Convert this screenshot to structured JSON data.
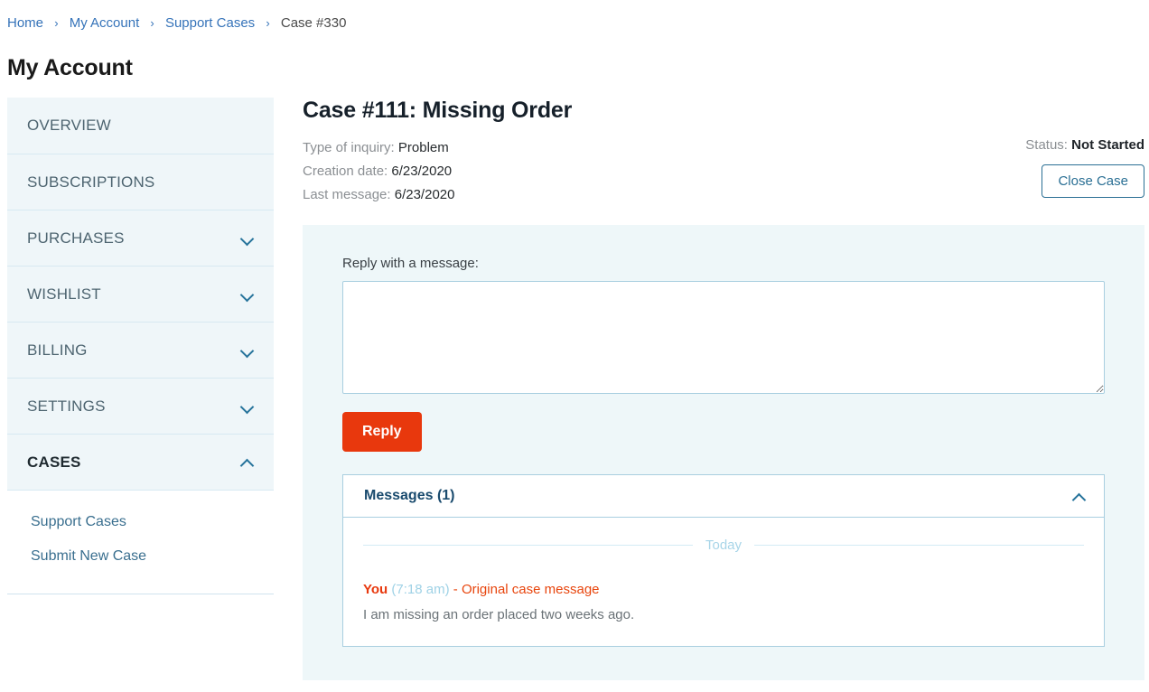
{
  "breadcrumb": {
    "separator": "›",
    "items": [
      {
        "label": "Home",
        "current": false
      },
      {
        "label": "My Account",
        "current": false
      },
      {
        "label": "Support Cases",
        "current": false
      },
      {
        "label": "Case #330",
        "current": true
      }
    ]
  },
  "page_title": "My Account",
  "sidebar": {
    "items": [
      {
        "label": "OVERVIEW",
        "chevron": "none",
        "active": false
      },
      {
        "label": "SUBSCRIPTIONS",
        "chevron": "none",
        "active": false
      },
      {
        "label": "PURCHASES",
        "chevron": "chevron-down-icon",
        "active": false
      },
      {
        "label": "WISHLIST",
        "chevron": "chevron-down-icon",
        "active": false
      },
      {
        "label": "BILLING",
        "chevron": "chevron-down-icon",
        "active": false
      },
      {
        "label": "SETTINGS",
        "chevron": "chevron-down-icon",
        "active": false
      },
      {
        "label": "CASES",
        "chevron": "chevron-up-icon",
        "active": true
      }
    ],
    "subnav": [
      {
        "label": "Support Cases"
      },
      {
        "label": "Submit New Case"
      }
    ]
  },
  "case": {
    "title": "Case #111: Missing Order",
    "meta": [
      {
        "label": "Type of inquiry:",
        "value": "Problem"
      },
      {
        "label": "Creation date:",
        "value": "6/23/2020"
      },
      {
        "label": "Last message:",
        "value": "6/23/2020"
      }
    ],
    "status_label": "Status:",
    "status_value": "Not Started",
    "close_button": "Close Case"
  },
  "reply": {
    "label": "Reply with a message:",
    "textarea_value": "",
    "textarea_placeholder": "",
    "button_label": "Reply"
  },
  "messages": {
    "header": "Messages (1)",
    "collapse_icon": "chevron-up-icon",
    "day_divider": "Today",
    "list": [
      {
        "author": "You",
        "time": "(7:18 am)",
        "separator": " - ",
        "subject": "Original case message",
        "text": "I am missing an order placed two weeks ago."
      }
    ]
  },
  "colors": {
    "accent_red": "#e8380d",
    "link_blue": "#3573b9",
    "panel_bg": "#eef7f9",
    "sidebar_bg": "#eff6f9",
    "border_blue": "#a9cfe0",
    "heading_navy": "#1a4b6e"
  }
}
